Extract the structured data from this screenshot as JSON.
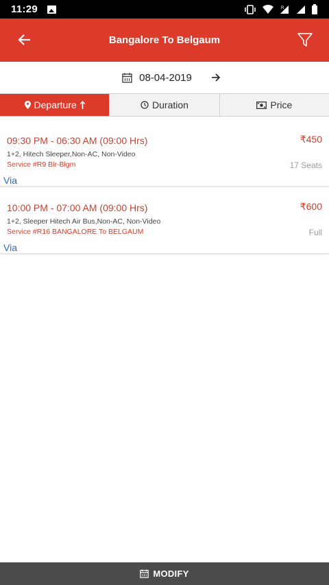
{
  "status_bar": {
    "time": "11:29",
    "icons": [
      "image-icon",
      "vibrate-icon",
      "wifi-icon",
      "signal-r-icon",
      "signal-icon",
      "battery-icon"
    ]
  },
  "app_bar": {
    "title": "Bangalore To Belgaum",
    "back_icon": "arrow-left-icon",
    "filter_icon": "filter-icon",
    "bg_color": "#dc3b2b"
  },
  "date": {
    "value": "08-04-2019",
    "calendar_icon": "calendar-icon",
    "next_icon": "arrow-right-icon"
  },
  "sort_tabs": [
    {
      "label": "Departure",
      "icon": "map-pin-icon",
      "sort_icon": "arrow-up-icon",
      "active": true
    },
    {
      "label": "Duration",
      "icon": "clock-icon",
      "active": false
    },
    {
      "label": "Price",
      "icon": "money-icon",
      "active": false
    }
  ],
  "results": [
    {
      "time": "09:30 PM - 06:30 AM (09:00 Hrs)",
      "price": "₹450",
      "bus_type": "1+2, Hitech Sleeper,Non-AC, Non-Video",
      "service": "Service #R9 Blr-Blgm",
      "seats": "17 Seats",
      "via": "Via"
    },
    {
      "time": "10:00 PM - 07:00 AM (09:00 Hrs)",
      "price": "₹600",
      "bus_type": "1+2, Sleeper Hitech Air Bus,Non-AC, Non-Video",
      "service": "Service #R16 BANGALORE To BELGAUM",
      "seats": "Full",
      "via": "Via"
    }
  ],
  "modify": {
    "label": "MODIFY",
    "icon": "calendar-icon"
  },
  "colors": {
    "accent": "#dc3b2b",
    "link": "#2e6ab3",
    "footer": "#4b4b4b"
  }
}
